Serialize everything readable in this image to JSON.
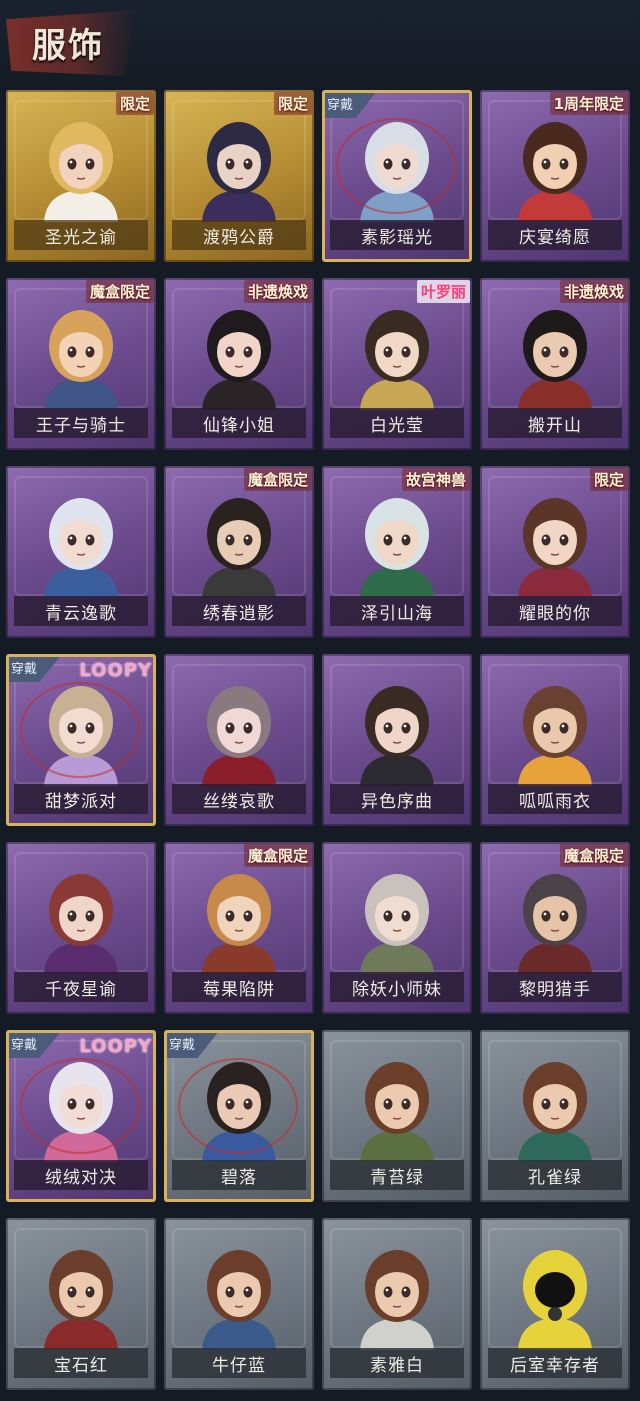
{
  "header": {
    "title": "服饰"
  },
  "costumes": [
    {
      "name": "圣光之谕",
      "badge": "限定",
      "style": "gold",
      "worn": false,
      "hair": "#e0b860",
      "skin": "#f2d3bd",
      "outfit": "#f4efe6"
    },
    {
      "name": "渡鸦公爵",
      "badge": "限定",
      "style": "gold",
      "worn": false,
      "hair": "#2c2a44",
      "skin": "#e9d2c6",
      "outfit": "#3b2e5c"
    },
    {
      "name": "素影瑶光",
      "badge": "",
      "style": "purple",
      "worn": true,
      "hair": "#d8dde6",
      "skin": "#f0dbd2",
      "outfit": "#7e9fc8"
    },
    {
      "name": "庆宴绮愿",
      "badge": "1周年限定",
      "style": "purple",
      "worn": false,
      "hair": "#4a2a1e",
      "skin": "#f1d0b4",
      "outfit": "#c23a3a"
    },
    {
      "name": "王子与骑士",
      "badge": "魔盒限定",
      "style": "purple",
      "worn": false,
      "hair": "#d7a35a",
      "skin": "#f2d3b6",
      "outfit": "#3f5588"
    },
    {
      "name": "仙锋小姐",
      "badge": "非遗焕戏",
      "style": "purple",
      "worn": false,
      "hair": "#1f1a1e",
      "skin": "#f1d5c8",
      "outfit": "#2b2426"
    },
    {
      "name": "白光莹",
      "badge": "叶罗丽",
      "style": "purple",
      "worn": false,
      "hair": "#3a2b22",
      "skin": "#f0d8c6",
      "outfit": "#c9a855",
      "badgeStyle": "pink"
    },
    {
      "name": "搬开山",
      "badge": "非遗焕戏",
      "style": "purple",
      "worn": false,
      "hair": "#1e1a1a",
      "skin": "#eacab0",
      "outfit": "#8a2e2a"
    },
    {
      "name": "青云逸歌",
      "badge": "",
      "style": "purple",
      "worn": false,
      "hair": "#dfe4ee",
      "skin": "#f2dcd2",
      "outfit": "#3a5f9c"
    },
    {
      "name": "绣春逍影",
      "badge": "魔盒限定",
      "style": "purple",
      "worn": false,
      "hair": "#2a221e",
      "skin": "#e8cdb6",
      "outfit": "#3a3a3a"
    },
    {
      "name": "泽引山海",
      "badge": "故宫神兽",
      "style": "purple",
      "worn": false,
      "hair": "#d9e2e4",
      "skin": "#efd8c8",
      "outfit": "#2f6b4a"
    },
    {
      "name": "耀眼的你",
      "badge": "限定",
      "style": "purple",
      "worn": false,
      "hair": "#5a3528",
      "skin": "#f1d6c6",
      "outfit": "#8a2a3c"
    },
    {
      "name": "甜梦派对",
      "badge": "",
      "style": "purple",
      "worn": true,
      "hair": "#c8b094",
      "skin": "#f2dcd2",
      "outfit": "#b89ad6",
      "loopy": "LOOPY"
    },
    {
      "name": "丝缕哀歌",
      "badge": "",
      "style": "purple",
      "worn": false,
      "hair": "#8a7a80",
      "skin": "#f0d8d4",
      "outfit": "#8a1e2a"
    },
    {
      "name": "异色序曲",
      "badge": "",
      "style": "purple",
      "worn": false,
      "hair": "#3a2a24",
      "skin": "#f0d6c8",
      "outfit": "#2a2a30"
    },
    {
      "name": "呱呱雨衣",
      "badge": "",
      "style": "purple",
      "worn": false,
      "hair": "#6a4030",
      "skin": "#eac8ac",
      "outfit": "#e8a23a"
    },
    {
      "name": "千夜星谕",
      "badge": "",
      "style": "purple",
      "worn": false,
      "hair": "#8a3a36",
      "skin": "#f0d6c8",
      "outfit": "#5a2e6e"
    },
    {
      "name": "莓果陷阱",
      "badge": "魔盒限定",
      "style": "purple",
      "worn": false,
      "hair": "#c88a4a",
      "skin": "#f0d4bc",
      "outfit": "#8a3a2a"
    },
    {
      "name": "除妖小师妹",
      "badge": "",
      "style": "purple",
      "worn": false,
      "hair": "#c9c2bc",
      "skin": "#f1dcd2",
      "outfit": "#6e7a5a"
    },
    {
      "name": "黎明猎手",
      "badge": "魔盒限定",
      "style": "purple",
      "worn": false,
      "hair": "#4a4248",
      "skin": "#e6c4a8",
      "outfit": "#6a2a2a"
    },
    {
      "name": "绒绒对决",
      "badge": "",
      "style": "purple",
      "worn": true,
      "hair": "#e8e4ee",
      "skin": "#f2dcd6",
      "outfit": "#d06a9a",
      "loopy": "LOOPY"
    },
    {
      "name": "碧落",
      "badge": "",
      "style": "gray",
      "worn": true,
      "hair": "#2a2220",
      "skin": "#eacab4",
      "outfit": "#3a5aa0"
    },
    {
      "name": "青苔绿",
      "badge": "",
      "style": "gray",
      "worn": false,
      "hair": "#6a3e2a",
      "skin": "#eccab0",
      "outfit": "#5a7040"
    },
    {
      "name": "孔雀绿",
      "badge": "",
      "style": "gray",
      "worn": false,
      "hair": "#6a3e2a",
      "skin": "#eccab0",
      "outfit": "#2e6a5a"
    },
    {
      "name": "宝石红",
      "badge": "",
      "style": "gray",
      "worn": false,
      "hair": "#6a3e2a",
      "skin": "#eccab0",
      "outfit": "#8a2a2a"
    },
    {
      "name": "牛仔蓝",
      "badge": "",
      "style": "gray",
      "worn": false,
      "hair": "#6a3e2a",
      "skin": "#eccab0",
      "outfit": "#3a5a8a"
    },
    {
      "name": "素雅白",
      "badge": "",
      "style": "gray",
      "worn": false,
      "hair": "#6a3e2a",
      "skin": "#eccab0",
      "outfit": "#d0d0cc"
    },
    {
      "name": "后室幸存者",
      "badge": "",
      "style": "gray",
      "worn": false,
      "hair": "#e6d23a",
      "skin": "#1a1a1a",
      "outfit": "#e6d23a",
      "helmet": true
    }
  ],
  "labels": {
    "worn": "穿戴"
  }
}
